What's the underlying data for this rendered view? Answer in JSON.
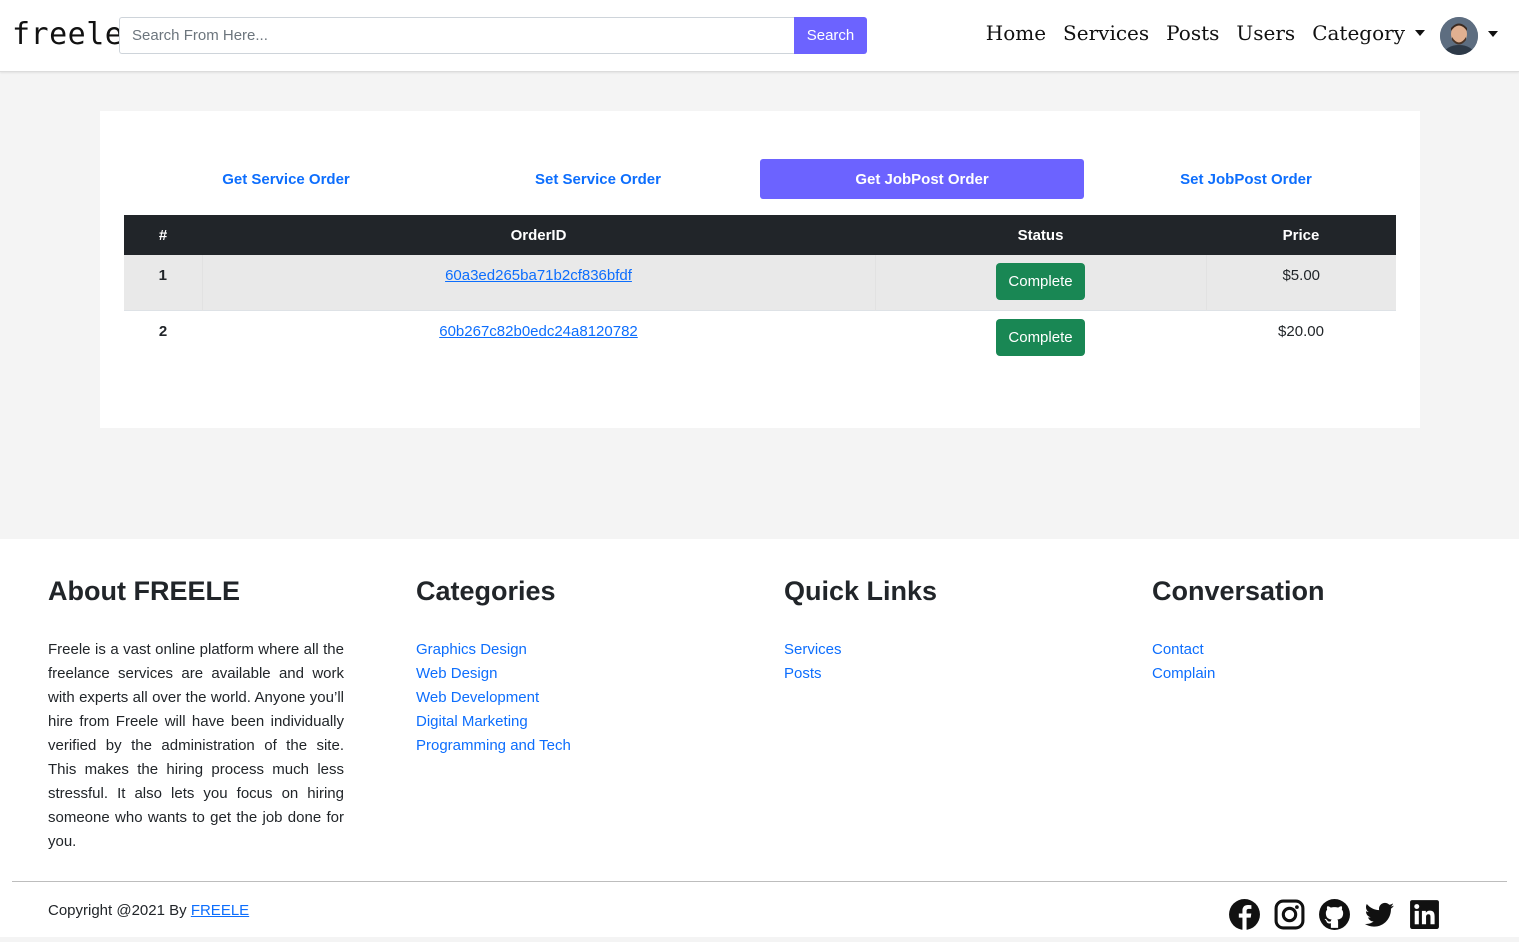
{
  "nav": {
    "brand": "freele",
    "search_placeholder": "Search From Here...",
    "search_button": "Search",
    "links": [
      "Home",
      "Services",
      "Posts",
      "Users",
      "Category"
    ]
  },
  "orders": {
    "tabs": [
      "Get Service Order",
      "Set Service Order",
      "Get JobPost Order",
      "Set JobPost Order"
    ],
    "active_tab": "Get JobPost Order",
    "headers": [
      "#",
      "OrderID",
      "Status",
      "Price"
    ],
    "rows": [
      {
        "num": "1",
        "order_id": "60a3ed265ba71b2cf836bfdf",
        "status": "Complete",
        "price": "$5.00"
      },
      {
        "num": "2",
        "order_id": "60b267c82b0edc24a8120782",
        "status": "Complete",
        "price": "$20.00"
      }
    ]
  },
  "footer": {
    "about_title": "About FREELE",
    "about_text": "Freele is a vast online platform where all the freelance services are available and work with experts all over the world. Anyone you’ll hire from Freele will have been individually verified by the administration of the site. This makes the hiring process much less stressful. It also lets you focus on hiring someone who wants to get the job done for you.",
    "categories_title": "Categories",
    "categories": [
      "Graphics Design",
      "Web Design",
      "Web Development",
      "Digital Marketing",
      "Programming and Tech"
    ],
    "quick_title": "Quick Links",
    "quick_links": [
      "Services",
      "Posts"
    ],
    "conv_title": "Conversation",
    "conv_links": [
      "Contact",
      "Complain"
    ],
    "copyright_prefix": "Copyright @2021 By ",
    "copyright_link": "FREELE",
    "social_icons": [
      "facebook-icon",
      "instagram-icon",
      "github-icon",
      "twitter-icon",
      "linkedin-icon"
    ]
  },
  "colors": {
    "accent": "#6c63ff",
    "link": "#0d6efd",
    "success": "#198754",
    "table_head": "#212529"
  }
}
